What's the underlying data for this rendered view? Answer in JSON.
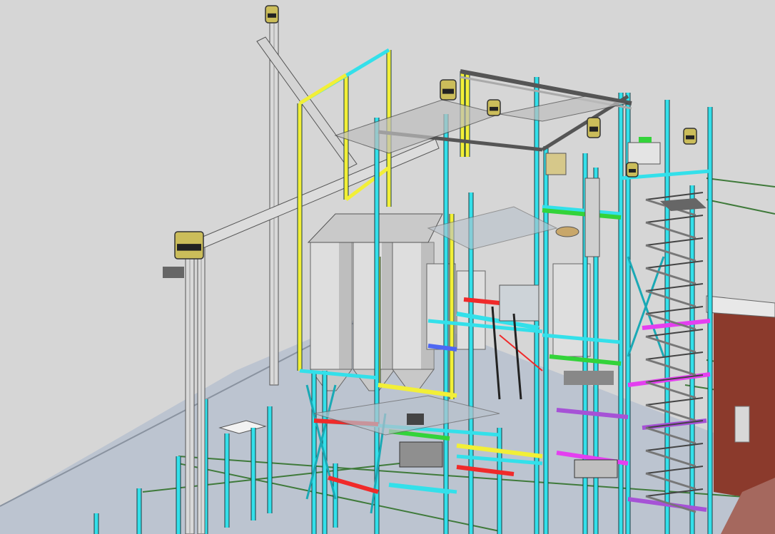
{
  "viewport": {
    "background": "#d6d6d6",
    "ground": "#bcc4d0",
    "ground_edge": "#8a93a0"
  },
  "palette": {
    "cyan": "#33e0ea",
    "cyan_dark": "#1aa9b5",
    "yellow": "#f2ef37",
    "green": "#33d33a",
    "red": "#f02a2a",
    "magenta": "#e43ff0",
    "blue": "#4e67f2",
    "purple": "#a652d6",
    "silo": "#dedede",
    "silo_shade": "#a9a9a9",
    "steel": "#9ea3a6",
    "dark_steel": "#5f6468",
    "brick": "#8b3a2c",
    "rail_green": "#3f7a3a",
    "elevator_head": "#cbbd5a"
  },
  "components": [
    {
      "name": "bucket-elevator",
      "count": 7
    },
    {
      "name": "storage-silo",
      "count": 6
    },
    {
      "name": "stair-tower",
      "count": 1
    },
    {
      "name": "screw-conveyor",
      "count": 2
    }
  ]
}
